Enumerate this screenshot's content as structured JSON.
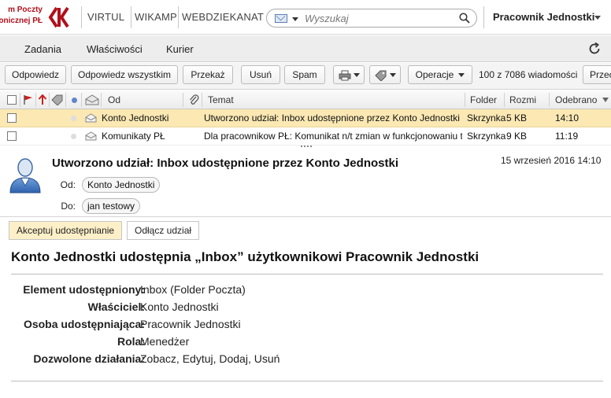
{
  "brand": {
    "line1": "m Poczty",
    "line2": "onicznej PŁ"
  },
  "topnav": {
    "links": [
      "VIRTUL",
      "WIKAMP",
      "WEBDZIEKANAT"
    ]
  },
  "search": {
    "placeholder": "Wyszukaj"
  },
  "user": {
    "name": "Pracownik Jednostki"
  },
  "menu": {
    "items": [
      "Zadania",
      "Właściwości",
      "Kurier"
    ]
  },
  "toolbar": {
    "reply": "Odpowiedz",
    "reply_all": "Odpowiedz wszystkim",
    "forward": "Przekaż",
    "delete": "Usuń",
    "spam": "Spam",
    "operations": "Operacje",
    "count": "100 z 7086 wiadomości",
    "cut": "Przec"
  },
  "columns": {
    "from": "Od",
    "subject": "Temat",
    "folder": "Folder",
    "size": "Rozmi",
    "received": "Odebrano"
  },
  "messages": [
    {
      "from": "Konto Jednostki",
      "subject": "Utworzono udział: Inbox udostępnione przez Konto Jednostki",
      "folder": "Skrzynka",
      "size": "5 KB",
      "received": "14:10"
    },
    {
      "from": "Komunikaty PŁ",
      "subject": "Dla pracownikow PŁ: Komunikat n/t zmian w funkcjonowaniu te",
      "folder": "Skrzynka",
      "size": "9 KB",
      "received": "11:19"
    }
  ],
  "preview": {
    "subject": "Utworzono udział: Inbox udostępnione przez Konto Jednostki",
    "date": "15 wrzesień 2016 14:10",
    "from_label": "Od:",
    "from": "Konto Jednostki",
    "to_label": "Do:",
    "to": "jan testowy",
    "accept": "Akceptuj udostępnianie",
    "detach": "Odłącz udział",
    "heading": "Konto Jednostki udostępnia „Inbox” użytkownikowi Pracownik Jednostki",
    "details": [
      {
        "key": "Element udostępniony:",
        "value": "Inbox (Folder Poczta)"
      },
      {
        "key": "Właściciel:",
        "value": "Konto Jednostki"
      },
      {
        "key": "Osoba udostępniająca:",
        "value": "Pracownik Jednostki"
      },
      {
        "key": "Rola:",
        "value": "Menedżer"
      },
      {
        "key": "Dozwolone działania:",
        "value": "Zobacz, Edytuj, Dodaj, Usuń"
      }
    ]
  },
  "colors": {
    "brand_red": "#b0101c",
    "selected_row": "#fbe8b3",
    "accept_button": "#fdf0c8"
  },
  "icons": [
    "logo-ck",
    "envelope-icon",
    "search-icon",
    "refresh-icon",
    "print-icon",
    "tag-icon",
    "flag-icon",
    "attachment-icon",
    "avatar-icon"
  ]
}
